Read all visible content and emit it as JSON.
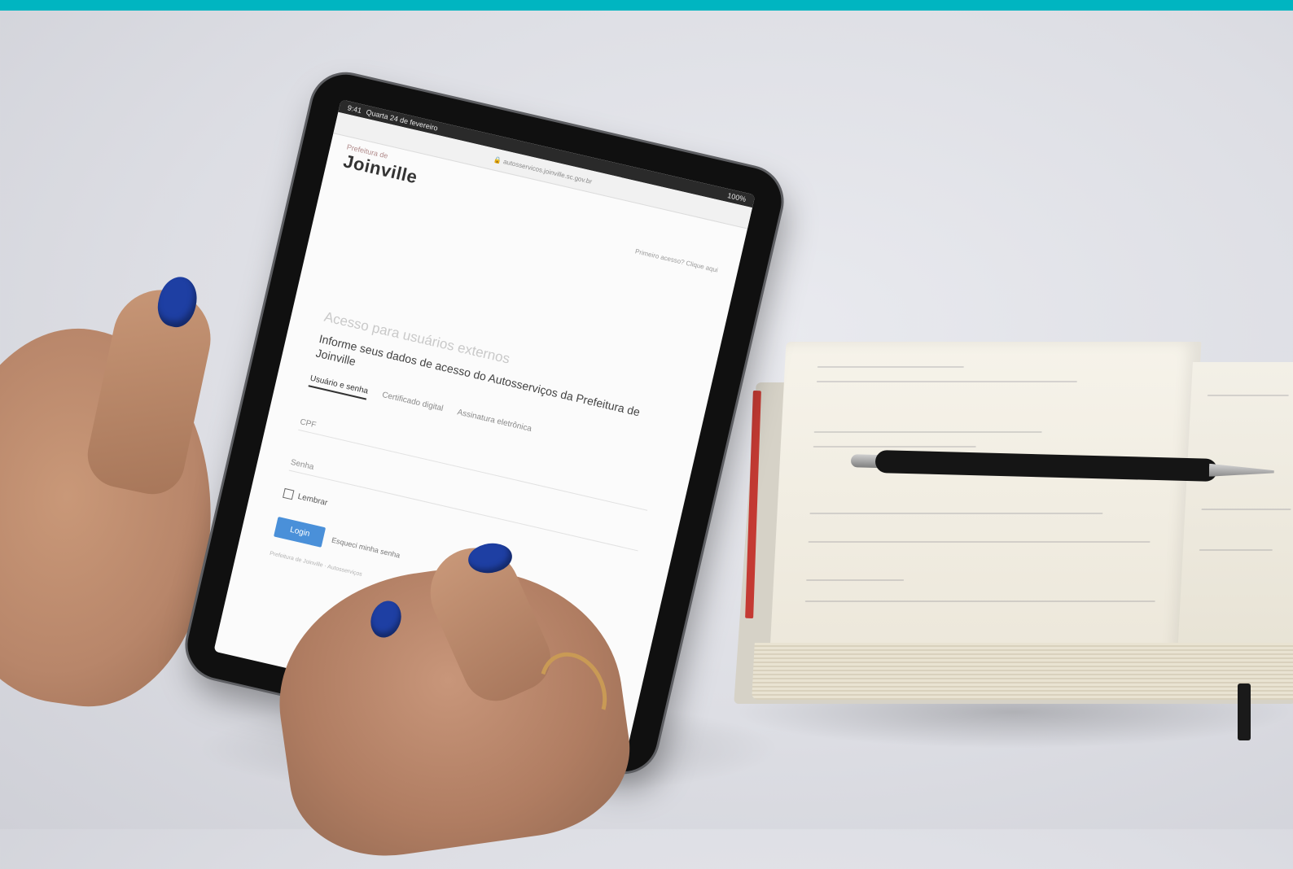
{
  "colors": {
    "top_band": "#00b5c1",
    "accent": "#4a90d9",
    "nail_polish": "#1e3fa3"
  },
  "tablet": {
    "statusbar": {
      "time": "9:41",
      "date": "Quarta 24 de fevereiro",
      "battery": "100%"
    },
    "address": "autosservicos.joinville.sc.gov.br",
    "logo": {
      "small": "Prefeitura de",
      "big": "Joinville"
    },
    "top_link": "Primeiro acesso? Clique aqui",
    "heading": "Acesso para usuários externos",
    "subtitle": "Informe seus dados de acesso do Autosserviços da Prefeitura de Joinville",
    "tabs": [
      {
        "label": "Usuário e senha",
        "active": true
      },
      {
        "label": "Certificado digital",
        "active": false
      },
      {
        "label": "Assinatura eletrônica",
        "active": false
      }
    ],
    "fields": {
      "cpf": "CPF",
      "password": "Senha"
    },
    "remember_label": "Lembrar",
    "login_label": "Login",
    "forgot_label": "Esqueci minha senha",
    "footer_note": "Prefeitura de Joinville · Autosserviços"
  }
}
